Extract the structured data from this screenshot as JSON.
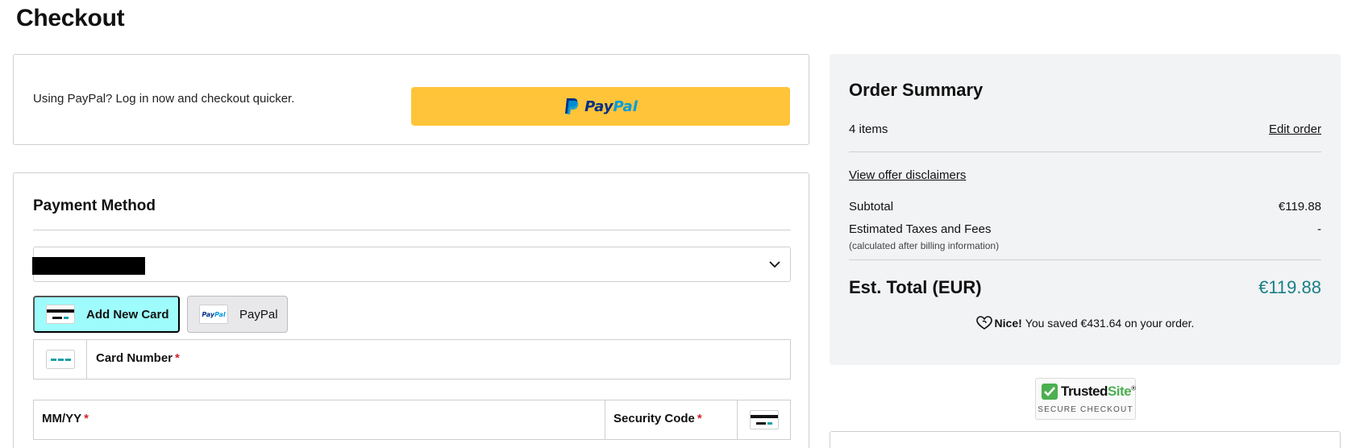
{
  "page": {
    "title": "Checkout"
  },
  "paypal_express": {
    "prompt": "Using PayPal? Log in now and checkout quicker.",
    "button_word_pay": "Pay",
    "button_word_pal": "Pal",
    "button_color": "#ffc439"
  },
  "payment": {
    "title": "Payment Method",
    "selected_method": "",
    "methods": [
      {
        "label": "Add New Card",
        "icon": "credit-card-icon",
        "selected": true
      },
      {
        "label": "PayPal",
        "icon": "paypal-logo-icon",
        "selected": false
      }
    ],
    "pp_mini_text": "PayPal",
    "fields": {
      "card_number": {
        "label": "Card Number",
        "required_mark": "*"
      },
      "expiry": {
        "label": "MM/YY",
        "required_mark": "*"
      },
      "security_code": {
        "label": "Security Code",
        "required_mark": "*"
      }
    },
    "accent_color": "#9ffcfc"
  },
  "summary": {
    "title": "Order Summary",
    "items_count": "4 items",
    "edit_order": "Edit order",
    "offer_disclaimers": "View offer disclaimers",
    "subtotal_label": "Subtotal",
    "subtotal_value": "€119.88",
    "taxes_label": "Estimated Taxes and Fees",
    "taxes_value": "-",
    "taxes_note": "(calculated after billing information)",
    "total_label": "Est. Total (EUR)",
    "total_value": "€119.88",
    "savings_nice": "Nice!",
    "savings_text": "You saved €431.64 on your order.",
    "total_color": "#1a7f86"
  },
  "trust_badge": {
    "brand_trusted": "Trusted",
    "brand_site": "Site",
    "tm": "®",
    "subtitle": "SECURE CHECKOUT"
  }
}
